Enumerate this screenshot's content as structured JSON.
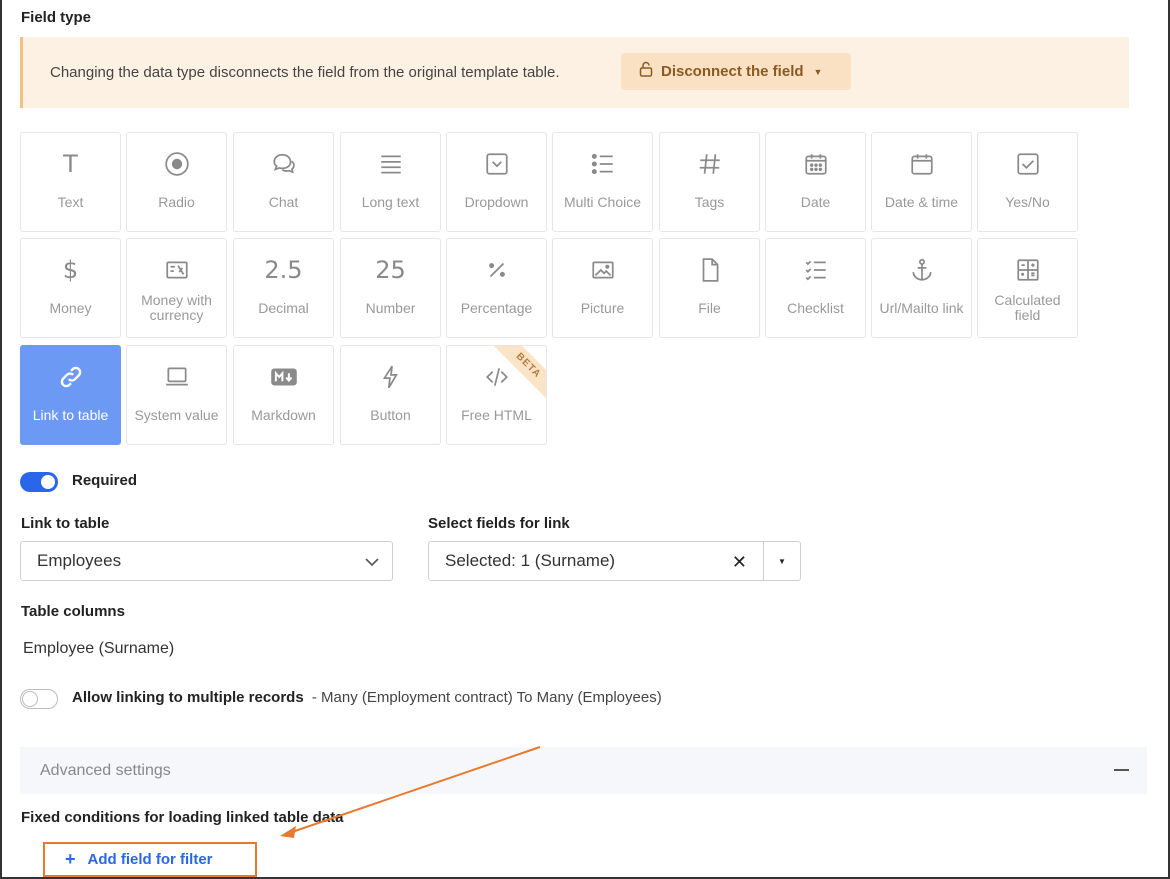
{
  "field_type": {
    "heading": "Field type",
    "warning_text": "Changing the data type disconnects the field from the original template table.",
    "disconnect_label": "Disconnect the field"
  },
  "types": [
    {
      "label": "Text",
      "icon": "text-icon"
    },
    {
      "label": "Radio",
      "icon": "radio-icon"
    },
    {
      "label": "Chat",
      "icon": "chat-icon"
    },
    {
      "label": "Long text",
      "icon": "long-text-icon"
    },
    {
      "label": "Dropdown",
      "icon": "dropdown-icon"
    },
    {
      "label": "Multi Choice",
      "icon": "multi-choice-icon"
    },
    {
      "label": "Tags",
      "icon": "hash-icon"
    },
    {
      "label": "Date",
      "icon": "calendar-icon"
    },
    {
      "label": "Date & time",
      "icon": "calendar-time-icon"
    },
    {
      "label": "Yes/No",
      "icon": "checkbox-icon"
    },
    {
      "label": "Money",
      "icon": "dollar-icon"
    },
    {
      "label": "Money with currency",
      "icon": "banknote-icon"
    },
    {
      "label": "Decimal",
      "icon": "decimal-icon",
      "glyph": "2.5"
    },
    {
      "label": "Number",
      "icon": "number-icon",
      "glyph": "25"
    },
    {
      "label": "Percentage",
      "icon": "percent-icon"
    },
    {
      "label": "Picture",
      "icon": "image-icon"
    },
    {
      "label": "File",
      "icon": "file-icon"
    },
    {
      "label": "Checklist",
      "icon": "checklist-icon"
    },
    {
      "label": "Url/Mailto link",
      "icon": "anchor-icon"
    },
    {
      "label": "Calculated field",
      "icon": "calculator-icon"
    },
    {
      "label": "Link to table",
      "icon": "link-icon",
      "selected": true
    },
    {
      "label": "System value",
      "icon": "laptop-icon"
    },
    {
      "label": "Markdown",
      "icon": "markdown-icon"
    },
    {
      "label": "Button",
      "icon": "bolt-icon"
    },
    {
      "label": "Free HTML",
      "icon": "code-icon",
      "badge": "BETA"
    }
  ],
  "required": {
    "label": "Required",
    "on": true
  },
  "link_to_table": {
    "label": "Link to table",
    "value": "Employees"
  },
  "select_fields": {
    "label": "Select fields for link",
    "value": "Selected: 1 (Surname)"
  },
  "table_columns": {
    "label": "Table columns",
    "value": "Employee (Surname)"
  },
  "multiple": {
    "label": "Allow linking to multiple records",
    "note": "- Many (Employment contract) To Many (Employees)",
    "on": false
  },
  "advanced": {
    "label": "Advanced settings"
  },
  "fixed_conditions": {
    "label": "Fixed conditions for loading linked table data"
  },
  "add_filter": {
    "label": "Add field for filter"
  },
  "colors": {
    "accent": "#2a66e8",
    "selected_tile": "#6b99f4",
    "warning_bg": "#fdf1e4",
    "annotation": "#e77a30"
  }
}
